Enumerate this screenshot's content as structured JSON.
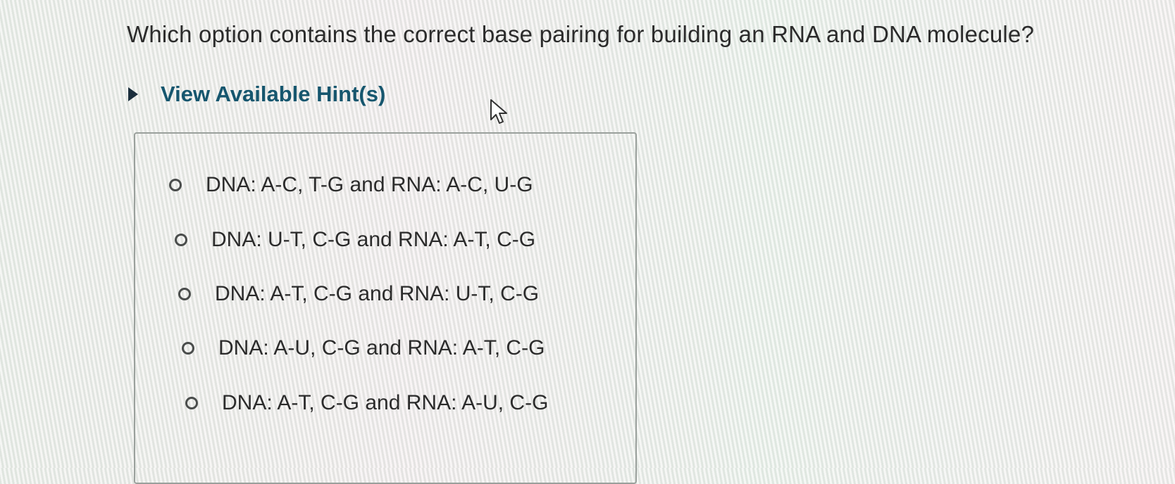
{
  "question": {
    "text": "Which option contains the correct base pairing for building an RNA and DNA molecule?"
  },
  "hint": {
    "label": "View Available Hint(s)",
    "icon": "caret-right-icon"
  },
  "options": [
    {
      "label": "DNA: A-C, T-G and RNA: A-C, U-G",
      "selected": false
    },
    {
      "label": "DNA: U-T, C-G and RNA: A-T, C-G",
      "selected": false
    },
    {
      "label": "DNA: A-T, C-G and RNA: U-T, C-G",
      "selected": false
    },
    {
      "label": "DNA: A-U, C-G and RNA: A-T, C-G",
      "selected": false
    },
    {
      "label": "DNA: A-T, C-G and RNA: A-U, C-G",
      "selected": false
    }
  ],
  "colors": {
    "hint_text": "#16566e",
    "text": "#2b2b2b",
    "box_border": "#9aa09c"
  }
}
